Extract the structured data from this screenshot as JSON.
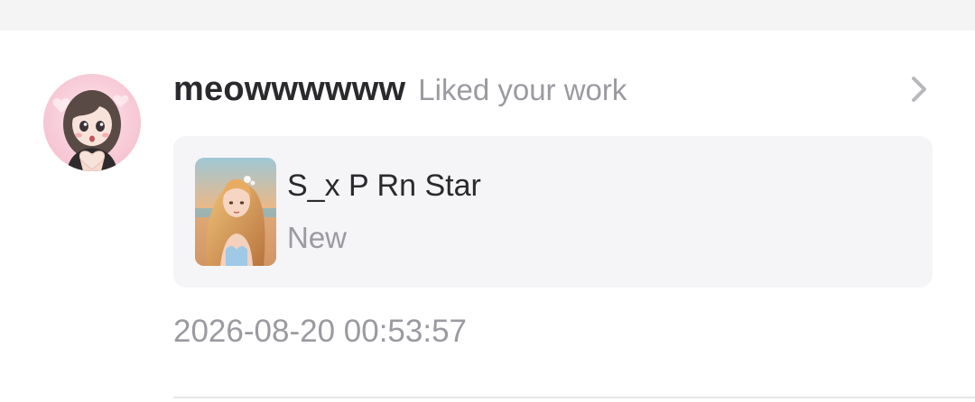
{
  "notification": {
    "username": "meowwwwww",
    "action": "Liked your work",
    "work": {
      "title": "S_x P Rn Star",
      "status": "New"
    },
    "timestamp": "2026-08-20 00:53:57"
  },
  "icons": {
    "avatar": "user-avatar",
    "chevron": "chevron-right-icon",
    "thumbnail": "work-thumbnail"
  },
  "colors": {
    "page_top": "#f4f4f5",
    "card_bg": "#f5f5f7",
    "primary_text": "#2a2a2e",
    "secondary_text": "#9a9aa0"
  }
}
